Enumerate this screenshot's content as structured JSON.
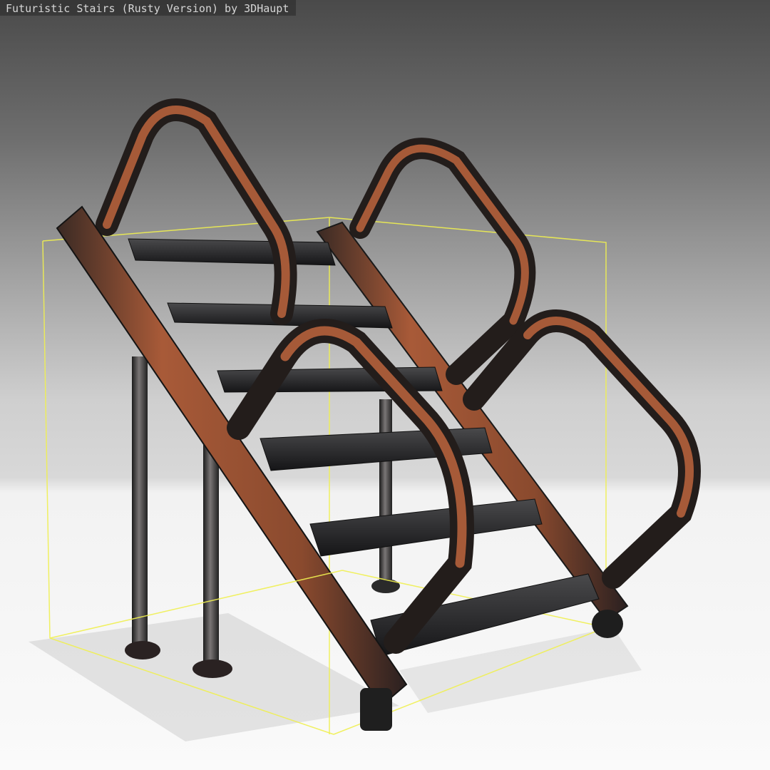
{
  "viewer": {
    "title": "Futuristic Stairs (Rusty Version) by 3DHaupt",
    "bounding_box_color": "#f0f050",
    "rust_color": "#b0603a",
    "metal_color": "#2c2c2e",
    "floor_color": "#f4f4f4"
  }
}
